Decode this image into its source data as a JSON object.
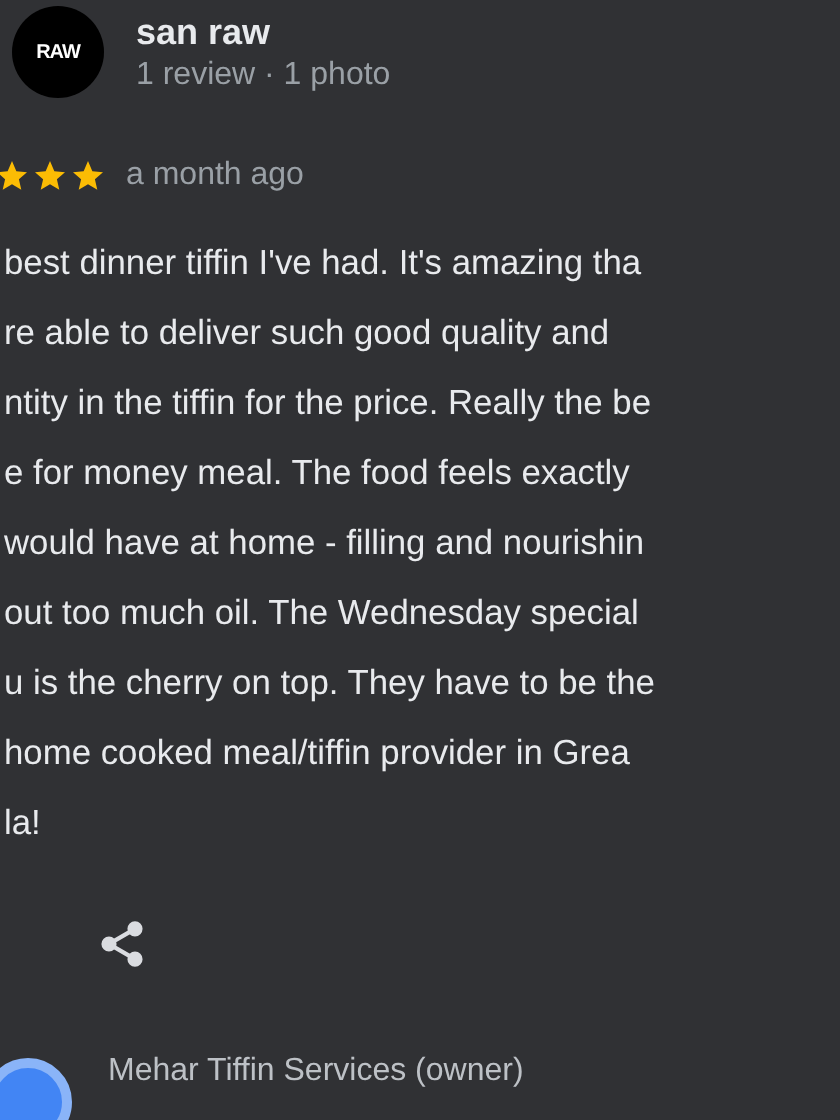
{
  "reviewer": {
    "avatar_text": "RAW",
    "name": "san raw",
    "meta": "1 review · 1 photo"
  },
  "review": {
    "stars": 3,
    "time": "a month ago",
    "lines": [
      "best dinner tiffin I've had. It's amazing tha",
      "re able to deliver such good quality and",
      "ntity in the tiffin for the price. Really the be",
      "e for money meal. The food feels exactly",
      "would have at home - filling and nourishin",
      "out too much oil. The Wednesday special",
      "u is the cherry on top. They have to be the",
      "home cooked meal/tiffin provider in Grea",
      "la!"
    ]
  },
  "owner_reply": {
    "name": "Mehar Tiffin Services (owner)"
  }
}
